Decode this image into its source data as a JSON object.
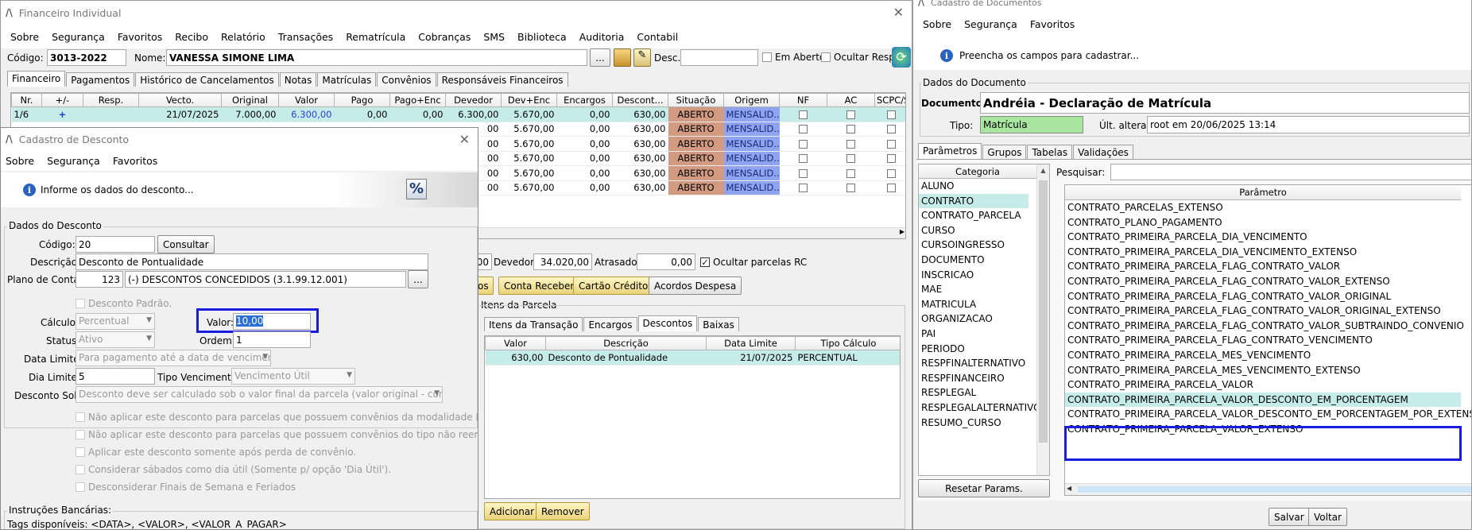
{
  "fin": {
    "title": "Financeiro Individual",
    "menu": [
      "Sobre",
      "Segurança",
      "Favoritos",
      "Recibo",
      "Relatório",
      "Transações",
      "Rematrícula",
      "Cobranças",
      "SMS",
      "Biblioteca",
      "Auditoria",
      "Contabil"
    ],
    "codigo_label": "Código:",
    "codigo": "3013-2022",
    "nome_label": "Nome:",
    "nome": "VANESSA SIMONE LIMA",
    "ellipsis": "...",
    "desc_label": "Desc.:",
    "em_aberto": "Em Aberto",
    "ocultar_resp": "Ocultar Resp.",
    "tabs": [
      "Financeiro",
      "Pagamentos",
      "Histórico de Cancelamentos",
      "Notas",
      "Matrículas",
      "Convênios",
      "Responsáveis Financeiros"
    ],
    "headers": [
      "Nr.",
      "+/-",
      "Resp.",
      "Vecto.",
      "Original",
      "Valor",
      "Pago",
      "Pago+Enc",
      "Devedor",
      "Dev+Enc",
      "Encargos",
      "Descont...",
      "Situação",
      "Origem",
      "NF",
      "AC",
      "SCPC/S"
    ],
    "row1": {
      "nr": "1/6",
      "plus": "+",
      "vecto": "21/07/2025",
      "original": "7.000,00",
      "valor": "6.300,00",
      "pago": "0,00",
      "pagoenc": "0,00",
      "devedor": "6.300,00",
      "devenc": "5.670,00",
      "encargos": "0,00",
      "desconto": "630,00",
      "situacao": "ABERTO",
      "origem": "MENSALID..."
    },
    "rows": [
      {
        "dev": "00",
        "devenc": "5.670,00",
        "encargos": "0,00",
        "desconto": "630,00",
        "situacao": "ABERTO",
        "origem": "MENSALID..."
      },
      {
        "dev": "00",
        "devenc": "5.670,00",
        "encargos": "0,00",
        "desconto": "630,00",
        "situacao": "ABERTO",
        "origem": "MENSALID..."
      },
      {
        "dev": "00",
        "devenc": "5.670,00",
        "encargos": "0,00",
        "desconto": "630,00",
        "situacao": "ABERTO",
        "origem": "MENSALID..."
      },
      {
        "dev": "00",
        "devenc": "5.670,00",
        "encargos": "0,00",
        "desconto": "630,00",
        "situacao": "ABERTO",
        "origem": "MENSALID..."
      },
      {
        "dev": "00",
        "devenc": "5.670,00",
        "encargos": "0,00",
        "desconto": "630,00",
        "situacao": "ABERTO",
        "origem": "MENSALID..."
      }
    ],
    "totals": {
      "frag": "00",
      "devedor_label": "Devedor:",
      "devedor": "34.020,00",
      "atrasado_label": "Atrasado:",
      "atrasado": "0,00",
      "ocultar_rc": "Ocultar parcelas RC"
    },
    "buttons": [
      "os",
      "Conta Receber",
      "Cartão Crédito",
      "Acordos Despesa"
    ],
    "itens_parcela": "Itens da Parcela",
    "sub_tabs": [
      "Itens da Transação",
      "Encargos",
      "Descontos",
      "Baixas"
    ],
    "sub_headers": [
      "Valor",
      "Descrição",
      "Data Limite",
      "Tipo Cálculo"
    ],
    "sub_row": {
      "valor": "630,00",
      "descricao": "Desconto de Pontualidade",
      "data": "21/07/2025",
      "tipo": "PERCENTUAL"
    },
    "adicionar": "Adicionar",
    "remover": "Remover"
  },
  "desc": {
    "title": "Cadastro de Desconto",
    "menu": [
      "Sobre",
      "Segurança",
      "Favoritos"
    ],
    "info": "Informe os dados do desconto...",
    "percent_icon": "%",
    "group": "Dados do Desconto",
    "codigo_label": "Código:",
    "codigo": "20",
    "consultar": "Consultar",
    "descricao_label": "Descrição:",
    "descricao": "Desconto de Pontualidade",
    "plano_label": "Plano de Conta:",
    "plano_num": "123",
    "plano_desc": "(-) DESCONTOS CONCEDIDOS (3.1.99.12.001)",
    "plano_btn": "...",
    "padrao": "Desconto Padrão.",
    "calculo_label": "Cálculo:",
    "calculo": "Percentual",
    "valor_label": "Valor:",
    "valor": "10,00",
    "status_label": "Status:",
    "status": "Ativo",
    "ordem_label": "Ordem:",
    "ordem": "1",
    "data_limite_label": "Data Limite:",
    "data_limite": "Para pagamento até a data de vencimento",
    "dia_limite_label": "Dia Limite:",
    "dia_limite": "5",
    "tipo_venc_label": "Tipo Vencimento:",
    "tipo_venc": "Vencimento Útil",
    "desconto_sob_label": "Desconto Sob:",
    "desconto_sob": "Desconto deve ser calculado sob o valor final da parcela (valor original - convênios)",
    "checks": [
      "Não aplicar este desconto para parcelas que possuem convênios da modalidade Bolsa.",
      "Não aplicar este desconto para parcelas que possuem convênios do tipo não reembolsável.",
      "Aplicar este desconto somente após perda de convênio.",
      "Considerar sábados como dia útil (Somente p/ opção 'Dia Útil').",
      "Desconsiderar Finais de Semana e Feriados"
    ],
    "instrucoes": "Instruções Bancárias:",
    "tags": "Tags disponíveis: <DATA>, <VALOR>, <VALOR_A_PAGAR>"
  },
  "doc": {
    "title": "Cadastro de Documentos",
    "menu": [
      "Sobre",
      "Segurança",
      "Favoritos"
    ],
    "info": "Preencha os campos para cadastrar...",
    "group": "Dados do Documento",
    "documento_label": "Documento:",
    "documento": "Andréia - Declaração de Matrícula",
    "tipo_label": "Tipo:",
    "tipo": "Matrícula",
    "ult_label": "Últ. alteração:",
    "ult": "root em 20/06/2025 13:14",
    "tabs": [
      "Parâmetros",
      "Grupos",
      "Tabelas",
      "Validações"
    ],
    "categoria_header": "Categoria",
    "categorias": [
      "ALUNO",
      "CONTRATO",
      "CONTRATO_PARCELA",
      "CURSO",
      "CURSOINGRESSO",
      "DOCUMENTO",
      "INSCRICAO",
      "MAE",
      "MATRICULA",
      "ORGANIZACAO",
      "PAI",
      "PERIODO",
      "RESPFINALTERNATIVO",
      "RESPFINANCEIRO",
      "RESPLEGAL",
      "RESPLEGALALTERNATIVO",
      "RESUMO_CURSO"
    ],
    "pesquisar_label": "Pesquisar:",
    "parametro_header": "Parâmetro",
    "parametros": [
      "CONTRATO_PARCELAS_EXTENSO",
      "CONTRATO_PLANO_PAGAMENTO",
      "CONTRATO_PRIMEIRA_PARCELA_DIA_VENCIMENTO",
      "CONTRATO_PRIMEIRA_PARCELA_DIA_VENCIMENTO_EXTENSO",
      "CONTRATO_PRIMEIRA_PARCELA_FLAG_CONTRATO_VALOR",
      "CONTRATO_PRIMEIRA_PARCELA_FLAG_CONTRATO_VALOR_EXTENSO",
      "CONTRATO_PRIMEIRA_PARCELA_FLAG_CONTRATO_VALOR_ORIGINAL",
      "CONTRATO_PRIMEIRA_PARCELA_FLAG_CONTRATO_VALOR_ORIGINAL_EXTENSO",
      "CONTRATO_PRIMEIRA_PARCELA_FLAG_CONTRATO_VALOR_SUBTRAINDO_CONVENIO",
      "CONTRATO_PRIMEIRA_PARCELA_FLAG_CONTRATO_VENCIMENTO",
      "CONTRATO_PRIMEIRA_PARCELA_MES_VENCIMENTO",
      "CONTRATO_PRIMEIRA_PARCELA_MES_VENCIMENTO_EXTENSO",
      "CONTRATO_PRIMEIRA_PARCELA_VALOR",
      "CONTRATO_PRIMEIRA_PARCELA_VALOR_DESCONTO_EM_PORCENTAGEM",
      "CONTRATO_PRIMEIRA_PARCELA_VALOR_DESCONTO_EM_PORCENTAGEM_POR_EXTENSO",
      "CONTRATO_PRIMEIRA_PARCELA_VALOR_EXTENSO"
    ],
    "resetar": "Resetar Params.",
    "salvar": "Salvar",
    "voltar": "Voltar"
  },
  "colors": {
    "highlight_box": "#1a1ae0",
    "selected_row": "#c6ecea",
    "aberto": "#d39a82",
    "mensalidade": "#8ea4f0"
  }
}
